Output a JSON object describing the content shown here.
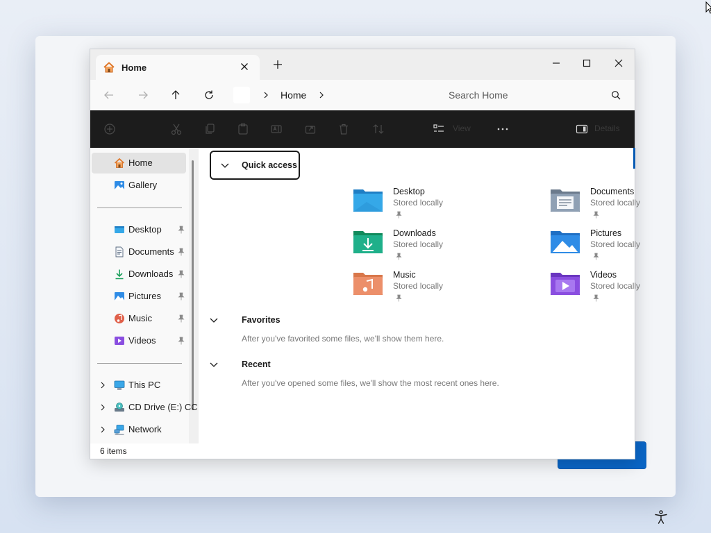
{
  "window": {
    "tab_title": "Home",
    "tab_icon": "home-icon"
  },
  "address": {
    "crumb": "Home",
    "search_placeholder": "Search Home"
  },
  "command_bar": {
    "items": [
      "new",
      "cut",
      "copy",
      "paste",
      "rename",
      "share",
      "delete",
      "sort",
      "view",
      "more",
      "details"
    ],
    "view_label": "View",
    "details_label": "Details"
  },
  "sidebar": {
    "top": [
      {
        "label": "Home",
        "icon": "home-icon",
        "selected": true
      },
      {
        "label": "Gallery",
        "icon": "gallery-icon",
        "selected": false
      }
    ],
    "pinned": [
      {
        "label": "Desktop",
        "icon": "desktop-folder-icon"
      },
      {
        "label": "Documents",
        "icon": "documents-icon"
      },
      {
        "label": "Downloads",
        "icon": "downloads-icon"
      },
      {
        "label": "Pictures",
        "icon": "pictures-icon"
      },
      {
        "label": "Music",
        "icon": "music-icon"
      },
      {
        "label": "Videos",
        "icon": "videos-icon"
      }
    ],
    "devices": [
      {
        "label": "This PC",
        "icon": "this-pc-icon"
      },
      {
        "label": "CD Drive (E:) CC",
        "icon": "cd-drive-icon"
      },
      {
        "label": "Network",
        "icon": "network-icon"
      }
    ]
  },
  "content": {
    "quick_access": {
      "title": "Quick access",
      "items": [
        {
          "name": "Desktop",
          "sub": "Stored locally",
          "icon": "desktop-folder-icon"
        },
        {
          "name": "Documents",
          "sub": "Stored locally",
          "icon": "documents-folder-icon"
        },
        {
          "name": "Downloads",
          "sub": "Stored locally",
          "icon": "downloads-folder-icon"
        },
        {
          "name": "Pictures",
          "sub": "Stored locally",
          "icon": "pictures-folder-icon"
        },
        {
          "name": "Music",
          "sub": "Stored locally",
          "icon": "music-folder-icon"
        },
        {
          "name": "Videos",
          "sub": "Stored locally",
          "icon": "videos-folder-icon"
        }
      ]
    },
    "favorites": {
      "title": "Favorites",
      "empty_text": "After you've favorited some files, we'll show them here."
    },
    "recent": {
      "title": "Recent",
      "empty_text": "After you've opened some files, we'll show the most recent ones here."
    }
  },
  "status": {
    "item_count": "6 items"
  },
  "colors": {
    "accent": "#0a66c7",
    "command_bar_bg": "#1c1c1c",
    "selected_bg": "#e3e3e3"
  }
}
